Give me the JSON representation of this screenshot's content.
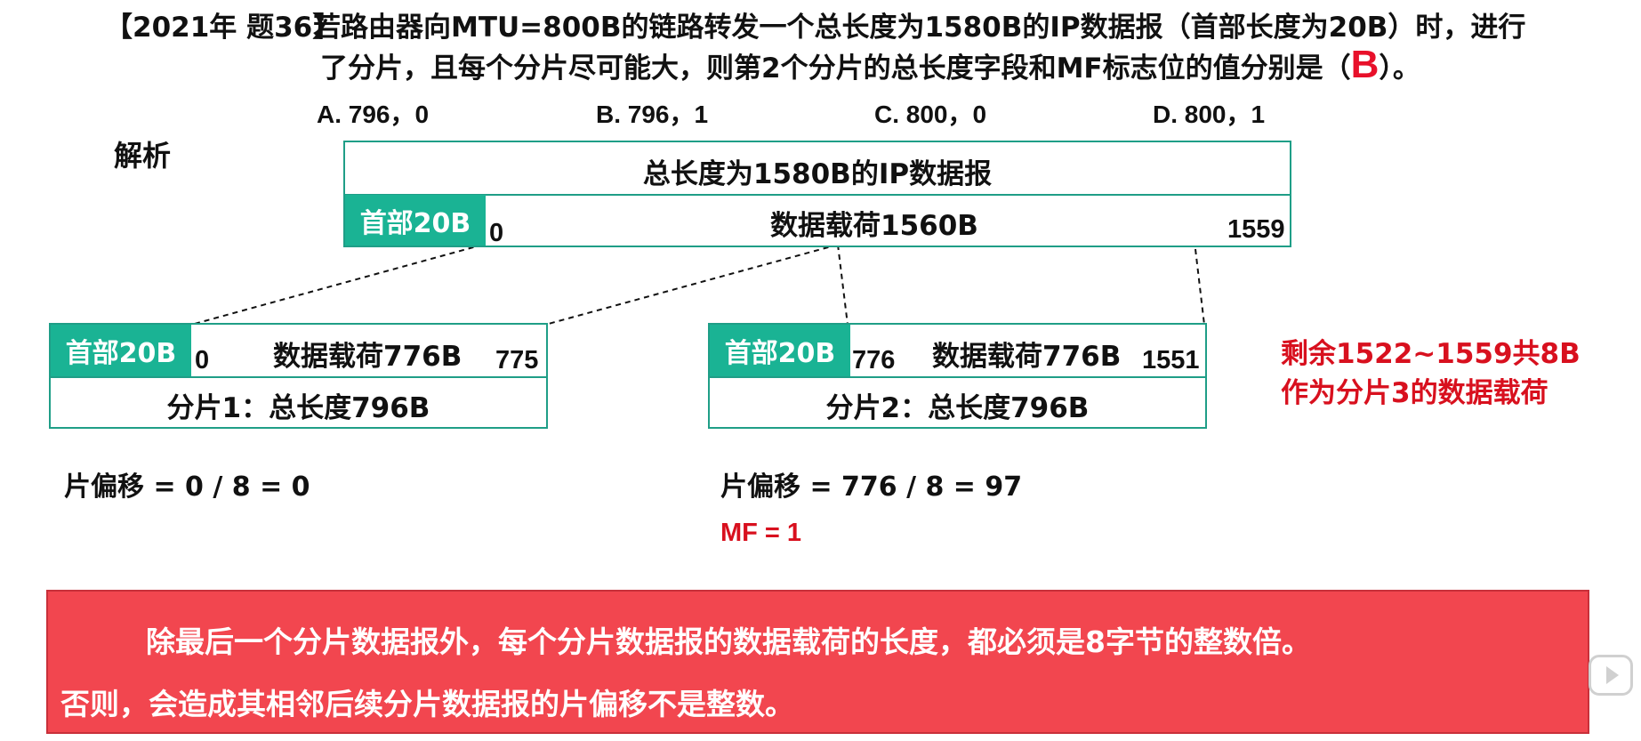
{
  "question": {
    "tag": "【2021年 题36】",
    "line1": "若路由器向MTU=800B的链路转发一个总长度为1580B的IP数据报（首部长度为20B）时，进行",
    "line2_before": "了分片，且每个分片尽可能大，则第2个分片的总长度字段和MF标志位的值分别是（",
    "answer": "B",
    "line2_after": "）。",
    "options": [
      "A. 796，0",
      "B. 796，1",
      "C. 800，0",
      "D. 800，1"
    ]
  },
  "analysis_label": "解析",
  "original": {
    "title": "总长度为1580B的IP数据报",
    "header": "首部20B",
    "payload": "数据载荷1560B",
    "start": "0",
    "end": "1559"
  },
  "fragment1": {
    "header": "首部20B",
    "payload": "数据载荷776B",
    "start": "0",
    "end": "775",
    "title": "分片1：总长度796B",
    "offset_text": "片偏移 = 0 / 8 = 0"
  },
  "fragment2": {
    "header": "首部20B",
    "payload": "数据载荷776B",
    "start": "776",
    "end": "1551",
    "title": "分片2：总长度796B",
    "offset_text": "片偏移 = 776 / 8 = 97",
    "mf_text": "MF = 1"
  },
  "remaining": {
    "line1": "剩余1522~1559共8B",
    "line2": "作为分片3的数据载荷"
  },
  "note": {
    "line1": "除最后一个分片数据报外，每个分片数据报的数据载荷的长度，都必须是8字节的整数倍。",
    "line2": "否则，会造成其相邻后续分片数据报的片偏移不是整数。"
  },
  "colors": {
    "header_fill": "#1ab394",
    "box_border": "#1f9e87",
    "answer_red": "#e8102a",
    "note_fill": "#f2464f"
  }
}
